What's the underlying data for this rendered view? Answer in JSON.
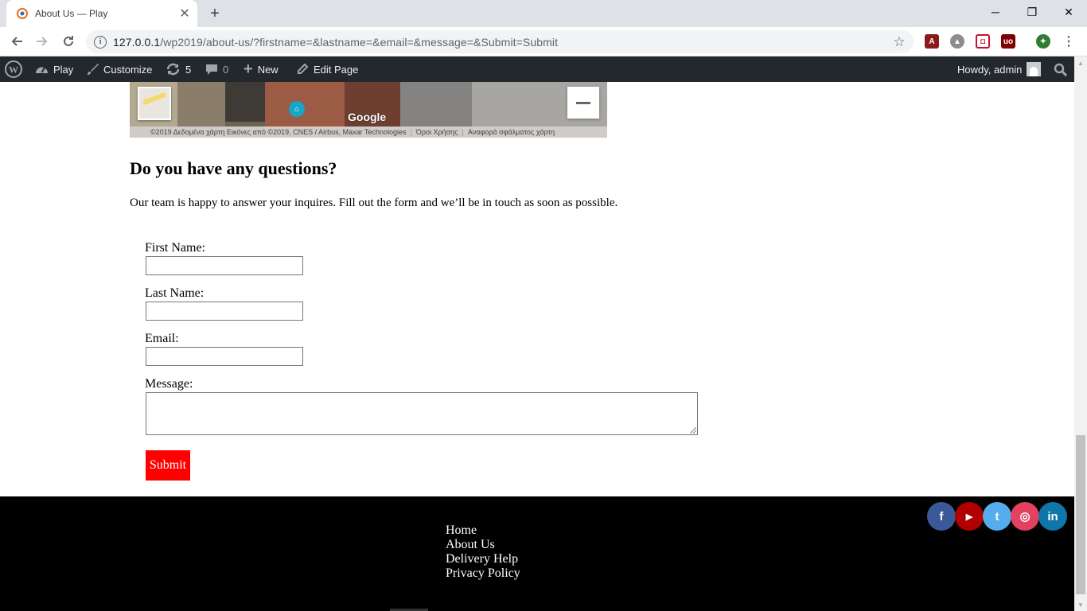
{
  "browser": {
    "tab_title": "About Us — Play",
    "tab_close": "✕",
    "new_tab": "+",
    "url_host": "127.0.0.1",
    "url_rest": "/wp2019/about-us/?firstname=&lastname=&email=&message=&Submit=Submit",
    "window_controls": {
      "minimize": "─",
      "restore": "❐",
      "close": "✕"
    },
    "icons": [
      "back-icon",
      "forward-icon",
      "reload-icon",
      "info-icon",
      "star-icon",
      "menu-icon"
    ]
  },
  "adminbar": {
    "site_name": "Play",
    "customize": "Customize",
    "updates_count": "5",
    "comments_count": "0",
    "new_label": "New",
    "edit_page": "Edit Page",
    "howdy": "Howdy, admin"
  },
  "map": {
    "attribution": "©2019 Δεδομένα χάρτη Εικόνες από ©2019, CNES / Airbus, Maxar Technologies",
    "terms": "Όροι Χρήσης",
    "report": "Αναφορά σφάλματος χάρτη",
    "google_logo": "Google"
  },
  "section": {
    "title": "Do you have any questions?",
    "text": "Our team is happy to answer your inquires. Fill out the form and we’ll be in touch as soon as possible."
  },
  "form": {
    "first_name_label": "First Name:",
    "last_name_label": "Last Name:",
    "email_label": "Email:",
    "message_label": "Message:",
    "submit_label": "Submit",
    "first_name_value": "",
    "last_name_value": "",
    "email_value": "",
    "message_value": ""
  },
  "footer": {
    "links": [
      "Home",
      "About Us",
      "Delivery Help",
      "Privacy Policy"
    ],
    "social": [
      {
        "name": "facebook",
        "glyph": "f",
        "color": "#3b5998"
      },
      {
        "name": "youtube",
        "glyph": "▶",
        "color": "#b00000"
      },
      {
        "name": "twitter",
        "glyph": "t",
        "color": "#55acee"
      },
      {
        "name": "instagram",
        "glyph": "◎",
        "color": "#e4405f"
      },
      {
        "name": "linkedin",
        "glyph": "in",
        "color": "#0e76a8"
      }
    ]
  },
  "colors": {
    "submit_bg": "#ff0000",
    "adminbar_bg": "#23282d",
    "footer_bg": "#000000"
  }
}
